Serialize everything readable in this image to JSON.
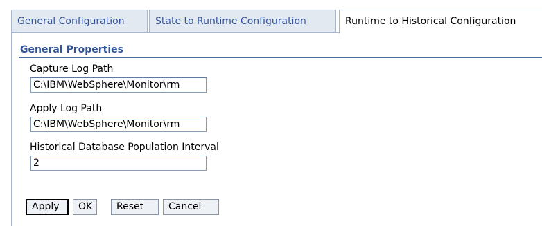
{
  "tabs": [
    {
      "label": "General Configuration",
      "active": false
    },
    {
      "label": "State to Runtime Configuration",
      "active": false
    },
    {
      "label": "Runtime to Historical Configuration",
      "active": true
    }
  ],
  "section": {
    "title": "General Properties"
  },
  "fields": {
    "capture_log_path": {
      "label": "Capture Log Path",
      "value": "C:\\IBM\\WebSphere\\Monitor\\rm"
    },
    "apply_log_path": {
      "label": "Apply Log Path",
      "value": "C:\\IBM\\WebSphere\\Monitor\\rm"
    },
    "population_interval": {
      "label": "Historical Database Population Interval",
      "value": "2"
    }
  },
  "buttons": {
    "apply": "Apply",
    "ok": "OK",
    "reset": "Reset",
    "cancel": "Cancel"
  },
  "colors": {
    "tab_inactive_bg": "#e3e9f1",
    "tab_text": "#33549a",
    "section_rule": "#4c6aa9",
    "border": "#a9b5c9"
  }
}
